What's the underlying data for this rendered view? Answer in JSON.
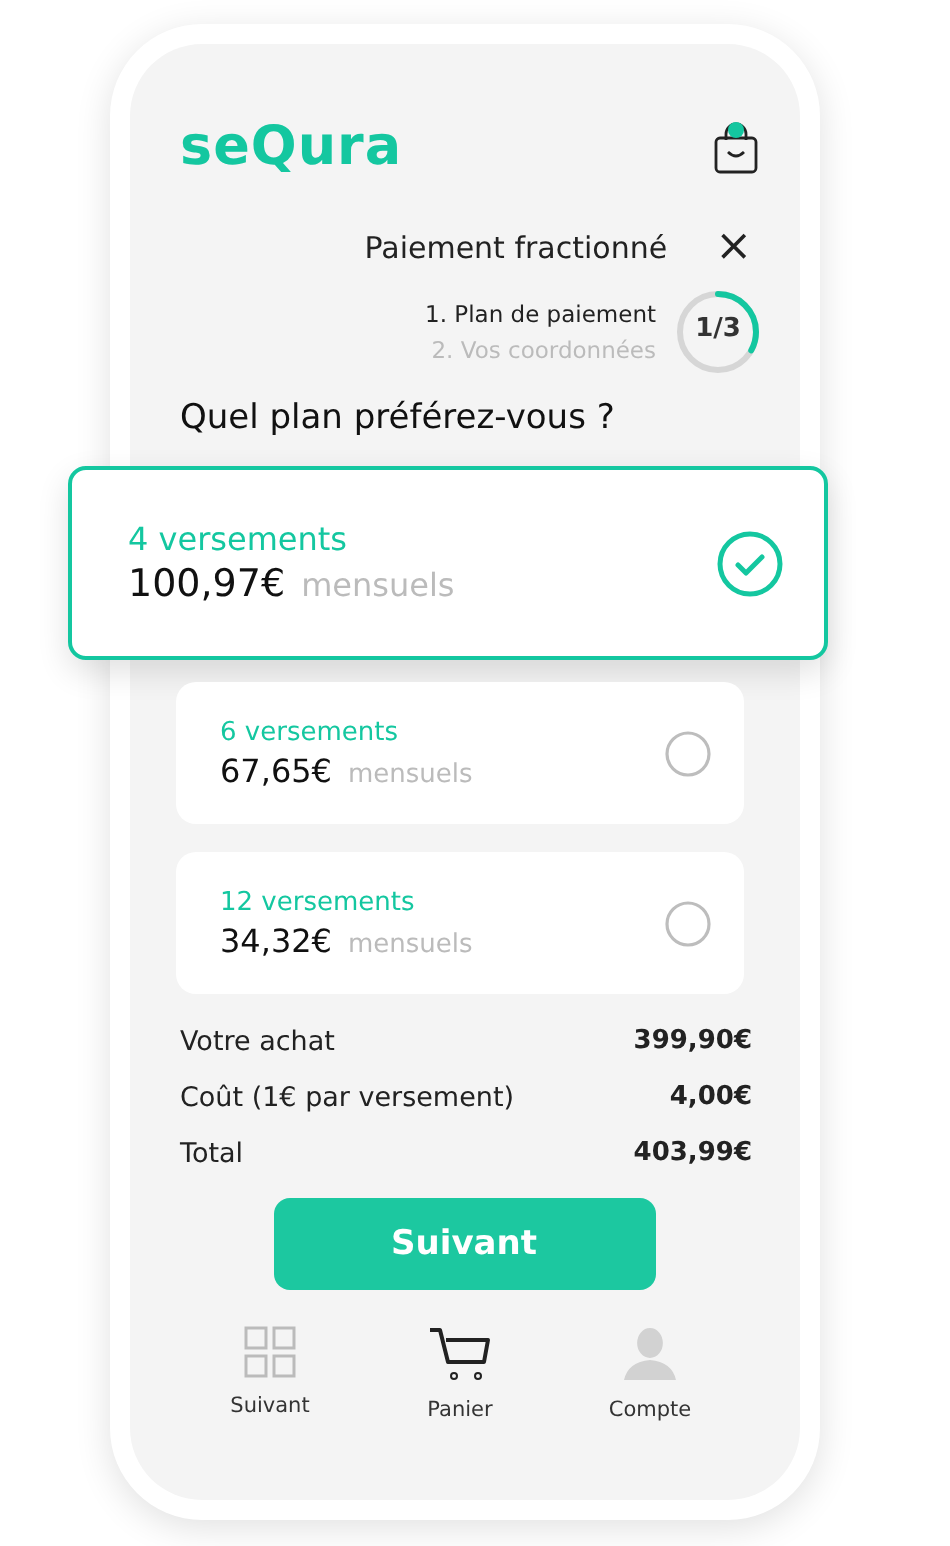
{
  "header": {
    "logo": "seQura",
    "cart_badge": true
  },
  "title": "Paiement fractionné",
  "close": "×",
  "steps": [
    {
      "label": "1. Plan de paiement",
      "active": true
    },
    {
      "label": "2. Vos coordonnées",
      "active": false
    }
  ],
  "progress": {
    "text": "1/3"
  },
  "question": "Quel plan préférez-vous ?",
  "plans": [
    {
      "label": "4 versements",
      "amount": "100,97€",
      "unit": "mensuels",
      "selected": true
    },
    {
      "label": "6 versements",
      "amount": "67,65€",
      "unit": "mensuels",
      "selected": false
    },
    {
      "label": "12 versements",
      "amount": "34,32€",
      "unit": "mensuels",
      "selected": false
    }
  ],
  "summary": [
    {
      "label": "Votre achat",
      "value": "399,90€"
    },
    {
      "label": "Coût (1€ par versement)",
      "value": "4,00€"
    },
    {
      "label": "Total",
      "value": "403,99€"
    }
  ],
  "button": "Suivant",
  "nav": [
    {
      "kind": "grid",
      "label": "Suivant",
      "active": false
    },
    {
      "kind": "cart",
      "label": "Panier",
      "active": true
    },
    {
      "kind": "account",
      "label": "Compte",
      "active": false
    }
  ]
}
